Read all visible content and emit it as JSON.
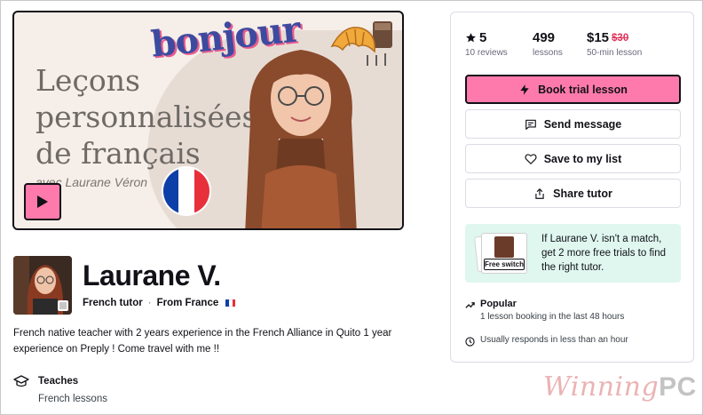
{
  "video": {
    "title_lines": [
      "Leçons",
      "personnalisées",
      "de français"
    ],
    "subtitle": "avec Laurane Véron",
    "logo_text": "bonjour",
    "play_icon": "play-icon"
  },
  "tutor": {
    "name": "Laurane V.",
    "role": "French tutor",
    "separator": "·",
    "origin": "From France",
    "bio": "French native teacher with 2 years experience in the French Alliance in Quito 1 year experience on Preply ! Come travel with me !!",
    "teaches_label": "Teaches",
    "teaches_value": "French lessons"
  },
  "stats": {
    "rating_value": "5",
    "rating_label": "10 reviews",
    "lessons_value": "499",
    "lessons_label": "lessons",
    "price_value": "$15",
    "price_old": "$30",
    "price_label": "50-min lesson"
  },
  "actions": {
    "book_trial": "Book trial lesson",
    "send_message": "Send message",
    "save_list": "Save to my list",
    "share": "Share tutor"
  },
  "promo": {
    "tag": "Free switch",
    "text": "If Laurane V. isn't a match, get 2 more free trials to find the right tutor."
  },
  "popularity": {
    "title": "Popular",
    "subtitle": "1 lesson booking in the last 48 hours",
    "response": "Usually responds in less than an hour"
  },
  "watermark": {
    "part1": "Winning",
    "part2": "PC"
  },
  "colors": {
    "accent_pink": "#ff7aac",
    "promo_bg": "#dff7ef",
    "old_price_red": "#e0325a",
    "flag_blue": "#0d3fa8",
    "flag_red": "#e8303b"
  }
}
